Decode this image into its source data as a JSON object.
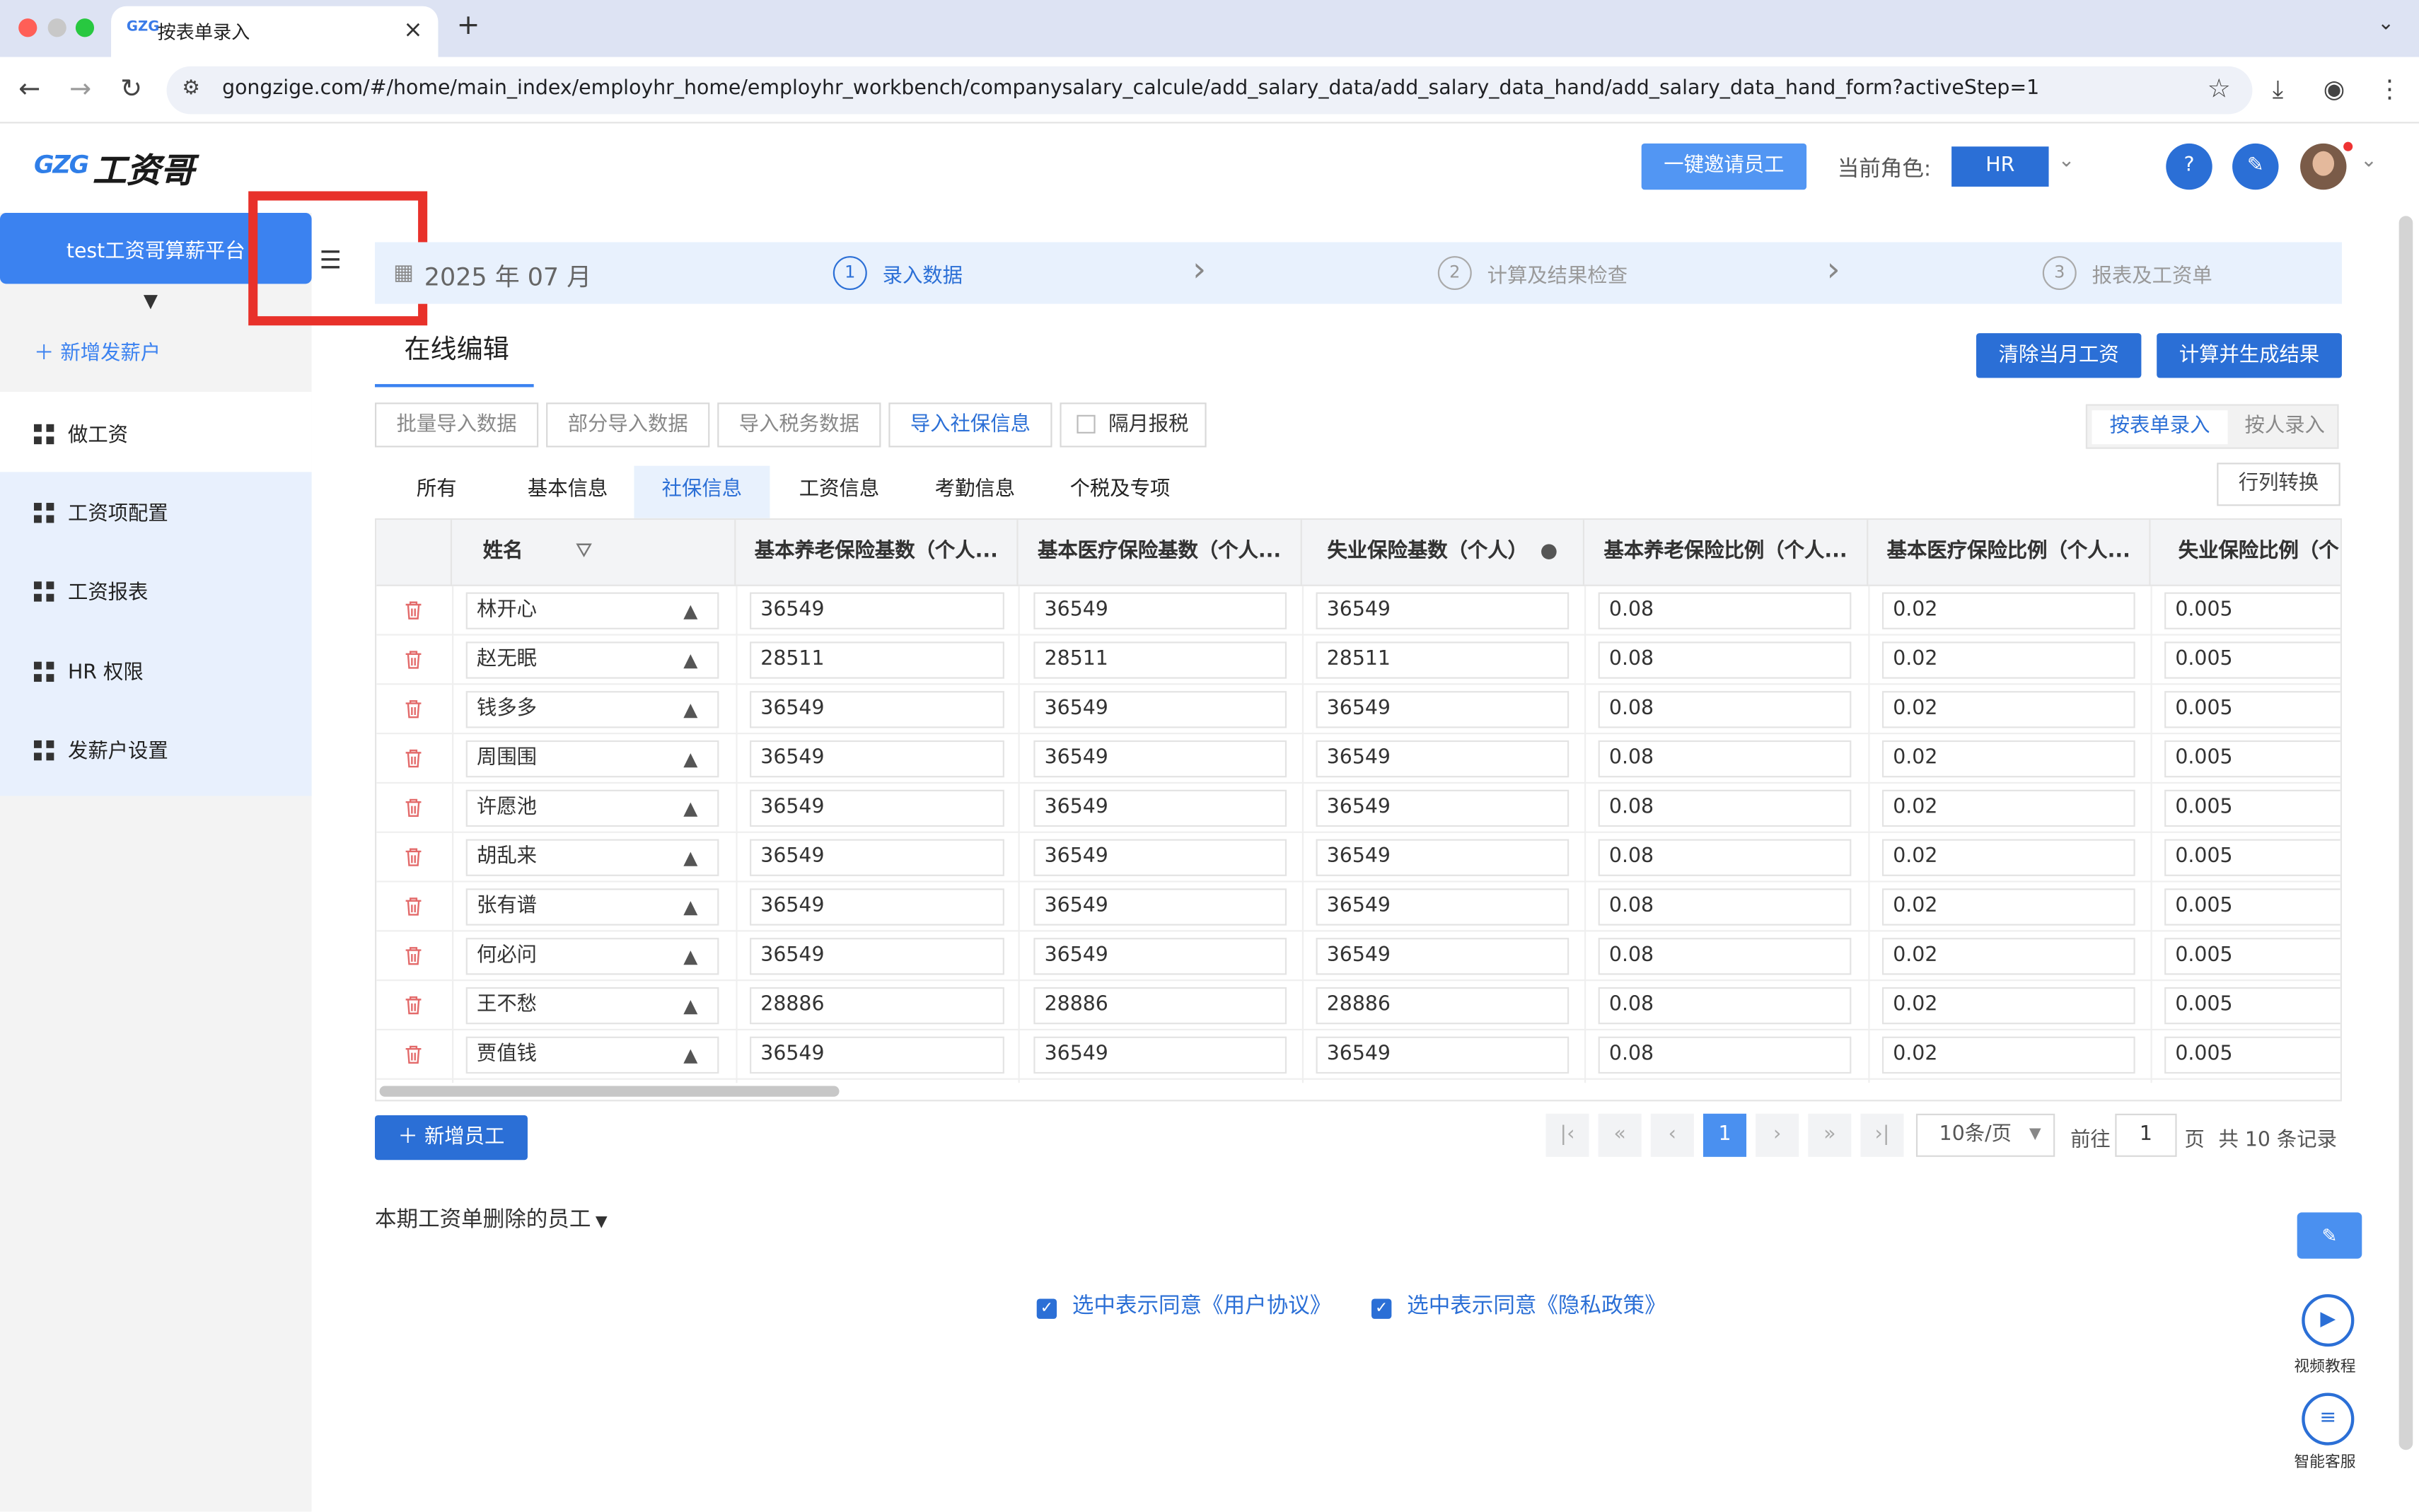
{
  "browser": {
    "tab_title": "按表单录入",
    "tab_favicon": "GZG",
    "url": "gongzige.com/#/home/main_index/employhr_home/employhr_workbench/companysalary_calcule/add_salary_data/add_salary_data_hand/add_salary_data_hand_form?activeStep=1"
  },
  "header": {
    "logo_mark": "GZG",
    "logo_text": "工资哥",
    "invite_btn": "一键邀请员工",
    "role_label": "当前角色:",
    "role_value": "HR",
    "help_icon": "?"
  },
  "sidebar": {
    "org_name": "test工资哥算薪平台",
    "add_payer": "新增发薪户",
    "items": [
      {
        "label": "做工资"
      },
      {
        "label": "工资项配置"
      },
      {
        "label": "工资报表"
      },
      {
        "label": "HR 权限"
      },
      {
        "label": "发薪户设置"
      }
    ]
  },
  "steps": {
    "date": "2025 年 07 月",
    "items": [
      {
        "num": "1",
        "label": "录入数据"
      },
      {
        "num": "2",
        "label": "计算及结果检查"
      },
      {
        "num": "3",
        "label": "报表及工资单"
      }
    ]
  },
  "main": {
    "title": "在线编辑",
    "clear_btn": "清除当月工资",
    "calc_btn": "计算并生成结果",
    "import_buttons": [
      "批量导入数据",
      "部分导入数据",
      "导入税务数据",
      "导入社保信息"
    ],
    "next_month_tax": "隔月报税",
    "mode_form": "按表单录入",
    "mode_person": "按人录入",
    "subtabs": [
      "所有",
      "基本信息",
      "社保信息",
      "工资信息",
      "考勤信息",
      "个税及专项"
    ],
    "convert_btn": "行列转换"
  },
  "table": {
    "columns": [
      "姓名",
      "基本养老保险基数（个人...",
      "基本医疗保险基数（个人...",
      "失业保险基数（个人）",
      "基本养老保险比例（个人...",
      "基本医疗保险比例（个人...",
      "失业保险比例（个..."
    ],
    "rows": [
      {
        "name": "林开心",
        "pension_base": "36549",
        "medical_base": "36549",
        "unemp_base": "36549",
        "pension_rate": "0.08",
        "medical_rate": "0.02",
        "unemp_rate": "0.005"
      },
      {
        "name": "赵无眠",
        "pension_base": "28511",
        "medical_base": "28511",
        "unemp_base": "28511",
        "pension_rate": "0.08",
        "medical_rate": "0.02",
        "unemp_rate": "0.005"
      },
      {
        "name": "钱多多",
        "pension_base": "36549",
        "medical_base": "36549",
        "unemp_base": "36549",
        "pension_rate": "0.08",
        "medical_rate": "0.02",
        "unemp_rate": "0.005"
      },
      {
        "name": "周围围",
        "pension_base": "36549",
        "medical_base": "36549",
        "unemp_base": "36549",
        "pension_rate": "0.08",
        "medical_rate": "0.02",
        "unemp_rate": "0.005"
      },
      {
        "name": "许愿池",
        "pension_base": "36549",
        "medical_base": "36549",
        "unemp_base": "36549",
        "pension_rate": "0.08",
        "medical_rate": "0.02",
        "unemp_rate": "0.005"
      },
      {
        "name": "胡乱来",
        "pension_base": "36549",
        "medical_base": "36549",
        "unemp_base": "36549",
        "pension_rate": "0.08",
        "medical_rate": "0.02",
        "unemp_rate": "0.005"
      },
      {
        "name": "张有谱",
        "pension_base": "36549",
        "medical_base": "36549",
        "unemp_base": "36549",
        "pension_rate": "0.08",
        "medical_rate": "0.02",
        "unemp_rate": "0.005"
      },
      {
        "name": "何必问",
        "pension_base": "36549",
        "medical_base": "36549",
        "unemp_base": "36549",
        "pension_rate": "0.08",
        "medical_rate": "0.02",
        "unemp_rate": "0.005"
      },
      {
        "name": "王不愁",
        "pension_base": "28886",
        "medical_base": "28886",
        "unemp_base": "28886",
        "pension_rate": "0.08",
        "medical_rate": "0.02",
        "unemp_rate": "0.005"
      },
      {
        "name": "贾值钱",
        "pension_base": "36549",
        "medical_base": "36549",
        "unemp_base": "36549",
        "pension_rate": "0.08",
        "medical_rate": "0.02",
        "unemp_rate": "0.005"
      }
    ]
  },
  "footer": {
    "add_employee": "新增员工",
    "current_page": "1",
    "page_size": "10条/页",
    "goto_label": "前往",
    "goto_value": "1",
    "page_unit": "页",
    "total": "共 10 条记录",
    "deleted_label": "本期工资单删除的员工",
    "agree_user": "选中表示同意《用户协议》",
    "agree_privacy": "选中表示同意《隐私政策》",
    "video_label": "视频教程",
    "service_label": "智能客服"
  }
}
